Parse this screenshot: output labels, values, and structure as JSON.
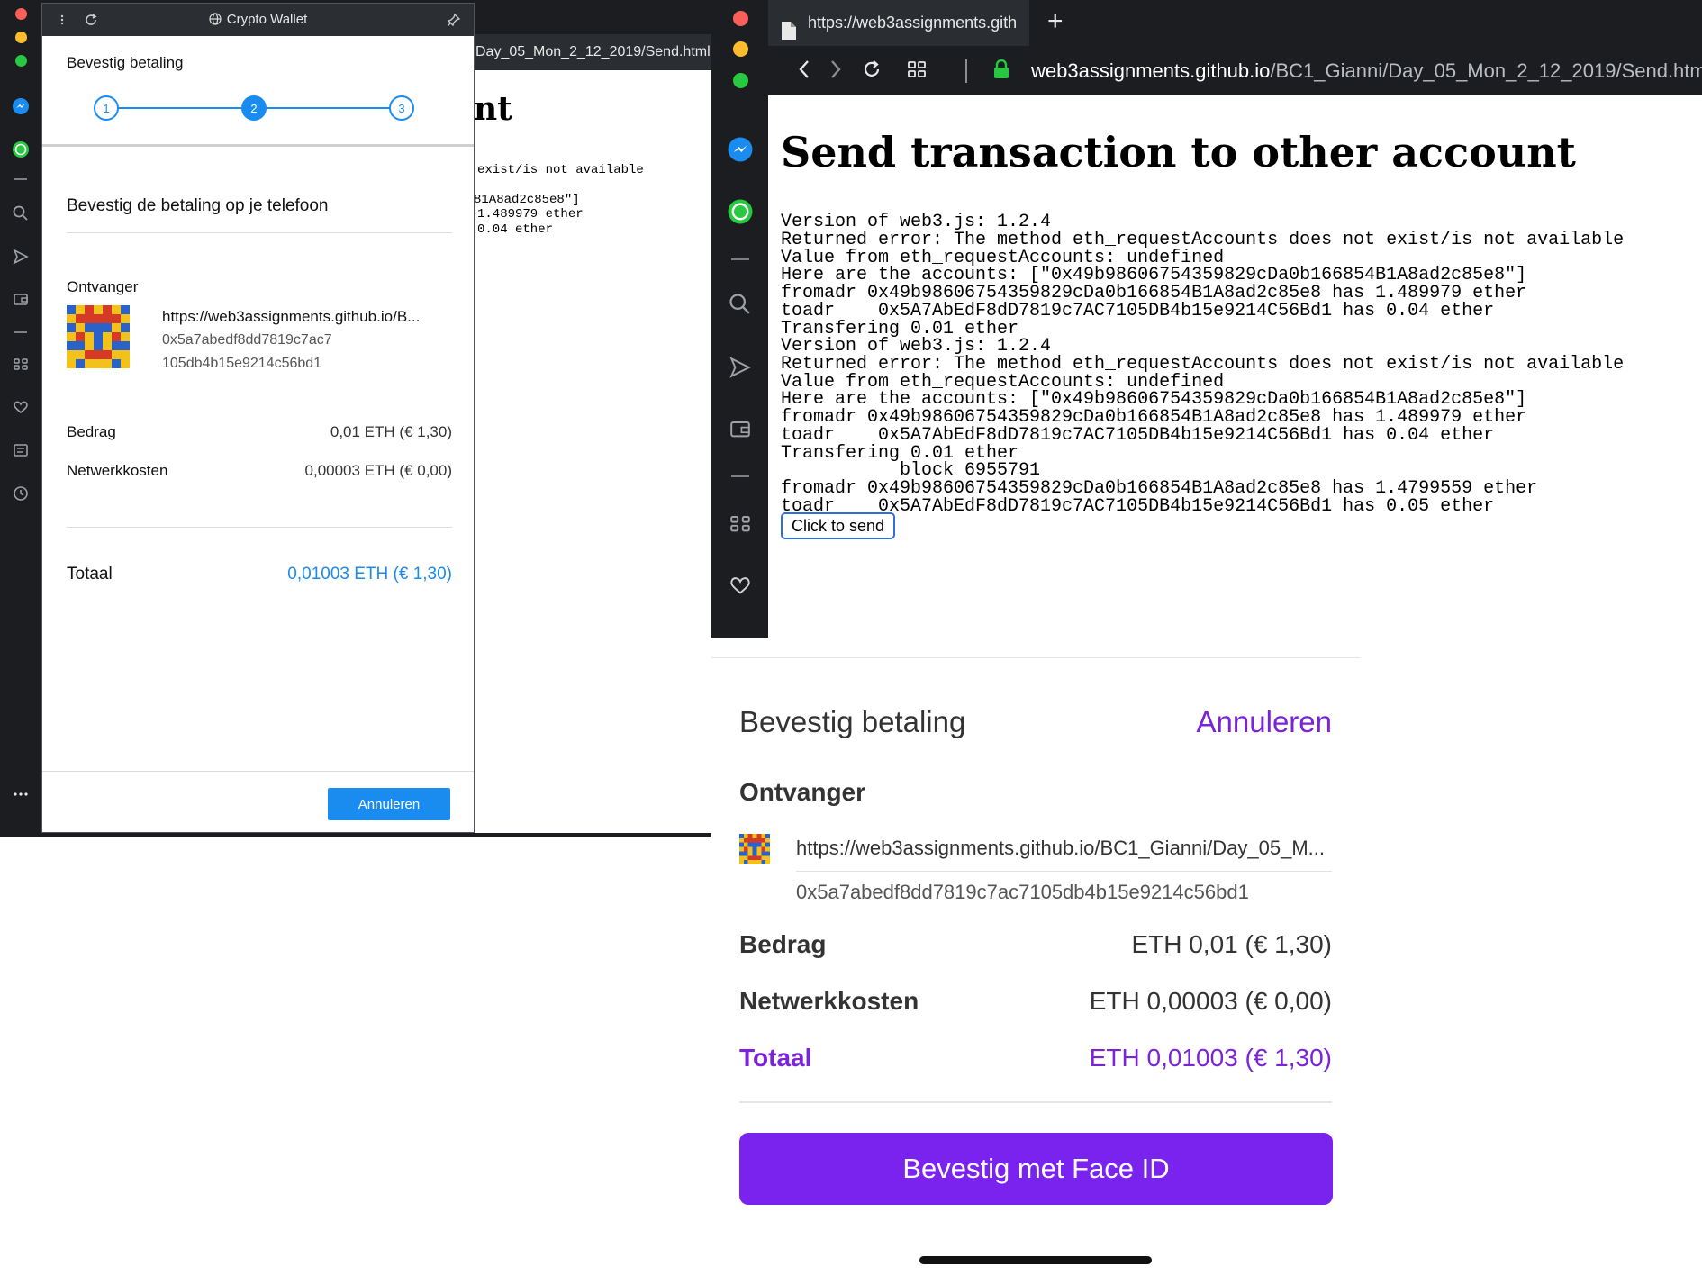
{
  "left_window": {
    "behind_tab": "Day_05_Mon_2_12_2019/Send.html",
    "behind_heading_fragment": "nt",
    "behind_lines": [
      "exist/is not available",
      "81A8ad2c85e8\"]",
      "1.489979 ether",
      "0.04 ether"
    ],
    "wallet": {
      "title": "Crypto Wallet",
      "header_title": "Bevestig betaling",
      "steps": [
        "1",
        "2",
        "3"
      ],
      "active_step": 2,
      "confirm_title": "Bevestig de betaling op je telefoon",
      "recipient_label": "Ontvanger",
      "recipient_url": "https://web3assignments.github.io/B...",
      "recipient_address_line1": "0x5a7abedf8dd7819c7ac7",
      "recipient_address_line2": "105db4b15e9214c56bd1",
      "amount_label": "Bedrag",
      "amount_value": "0,01 ETH (€ 1,30)",
      "fee_label": "Netwerkkosten",
      "fee_value": "0,00003 ETH (€ 0,00)",
      "total_label": "Totaal",
      "total_value": "0,01003 ETH (€ 1,30)",
      "cancel_label": "Annuleren"
    }
  },
  "right_browser": {
    "tab_title": "https://web3assignments.gith",
    "url_host": "web3assignments.github.io",
    "url_path": "/BC1_Gianni/Day_05_Mon_2_12_2019/Send.htm",
    "heading": "Send transaction to other account",
    "log_lines": [
      "Version of web3.js: 1.2.4",
      "Returned error: The method eth_requestAccounts does not exist/is not available",
      "Value from eth_requestAccounts: undefined",
      "Here are the accounts: [\"0x49b98606754359829cDa0b166854B1A8ad2c85e8\"]",
      "fromadr 0x49b98606754359829cDa0b166854B1A8ad2c85e8 has 1.489979 ether",
      "toadr    0x5A7AbEdF8dD7819c7AC7105DB4b15e9214C56Bd1 has 0.04 ether",
      "Transfering 0.01 ether",
      "Version of web3.js: 1.2.4",
      "Returned error: The method eth_requestAccounts does not exist/is not available",
      "Value from eth_requestAccounts: undefined",
      "Here are the accounts: [\"0x49b98606754359829cDa0b166854B1A8ad2c85e8\"]",
      "fromadr 0x49b98606754359829cDa0b166854B1A8ad2c85e8 has 1.489979 ether",
      "toadr    0x5A7AbEdF8dD7819c7AC7105DB4b15e9214C56Bd1 has 0.04 ether",
      "Transfering 0.01 ether",
      "           block 6955791",
      "fromadr 0x49b98606754359829cDa0b166854B1A8ad2c85e8 has 1.4799559 ether",
      "toadr    0x5A7AbEdF8dD7819c7AC7105DB4b15e9214C56Bd1 has 0.05 ether"
    ],
    "send_button": "Click to send"
  },
  "ios_sheet": {
    "title": "Bevestig betaling",
    "cancel": "Annuleren",
    "recipient_label": "Ontvanger",
    "recipient_url": "https://web3assignments.github.io/BC1_Gianni/Day_05_M...",
    "recipient_address": "0x5a7abedf8dd7819c7ac7105db4b15e9214c56bd1",
    "amount_label": "Bedrag",
    "amount_value": "ETH 0,01 (€ 1,30)",
    "fee_label": "Netwerkkosten",
    "fee_value": "ETH 0,00003 (€ 0,00)",
    "total_label": "Totaal",
    "total_value": "ETH 0,01003 (€ 1,30)",
    "confirm_label": "Bevestig met Face ID"
  },
  "colors": {
    "wallet_accent": "#1a8cf0",
    "ios_accent": "#7a23ee",
    "dark_chrome": "#1b1d20"
  },
  "icons": {
    "left_sidebar": [
      "messenger-icon",
      "whatsapp-icon",
      "search-icon",
      "send-icon",
      "wallet-icon",
      "grid-icon",
      "heart-icon",
      "news-icon",
      "history-icon",
      "more-icon"
    ],
    "right_sidebar": [
      "messenger-icon",
      "whatsapp-icon",
      "search-icon",
      "send-icon",
      "wallet-icon",
      "grid-icon",
      "heart-icon"
    ]
  }
}
